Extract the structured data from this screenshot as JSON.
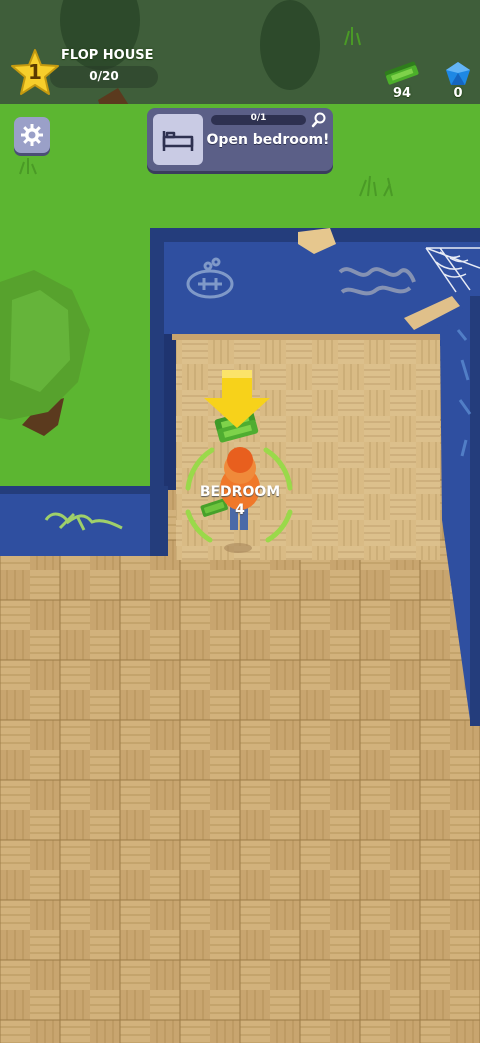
{
  "hud": {
    "level": {
      "number": "1",
      "title": "FLOP HOUSE",
      "progress_text": "0/20",
      "progress": 0.0
    },
    "currency": [
      {
        "name": "cash",
        "icon": "cash-icon",
        "value": "94",
        "color": "#4caf2a"
      },
      {
        "name": "gems",
        "icon": "gem-icon",
        "value": "0",
        "color": "#1e88e5"
      }
    ],
    "settings_icon": "gear-icon"
  },
  "quest": {
    "icon": "bed-icon",
    "progress_text": "0/1",
    "progress": 0.0,
    "label": "Open bedroom!",
    "search_icon": "magnifier-icon"
  },
  "world": {
    "room_label": "BEDROOM",
    "room_price": "4",
    "colors": {
      "grass": "#5cb631",
      "wall": "#2f4fa0",
      "floor": "#c9a46e",
      "tree": "#57a22d",
      "unlock_ring": "#9ad94a",
      "player": "#f0782a",
      "arrow": "#f7d21a"
    }
  }
}
